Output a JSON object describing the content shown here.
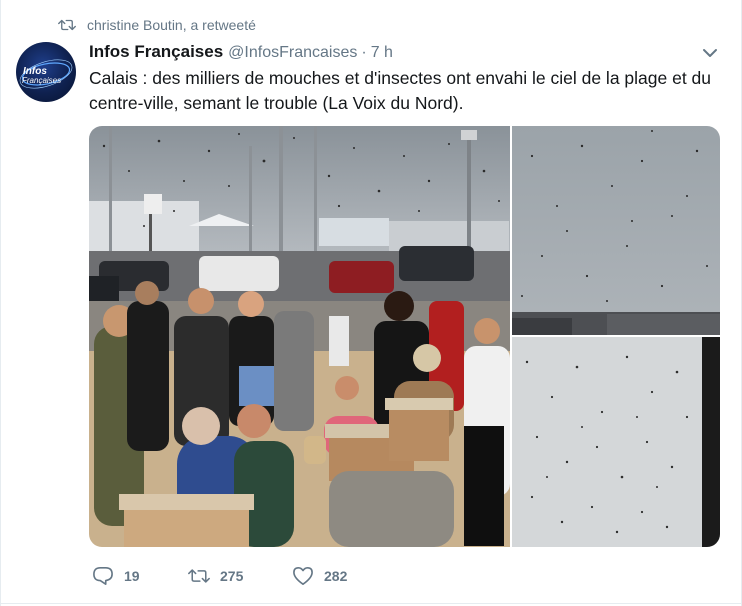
{
  "retweet": {
    "text": "christine Boutin, a retweeté",
    "icon": "retweet-icon"
  },
  "tweet": {
    "avatar_text": "Infos Françaises",
    "display_name": "Infos Françaises",
    "handle": "@InfosFrancaises",
    "separator": "·",
    "time": "7 h",
    "text_line1": "Calais : des milliers de mouches et d'insectes ont envahi le ciel de la plage et du",
    "text_line2": "centre-ville, semant le trouble (La Voix du Nord)."
  },
  "actions": {
    "reply_count": "19",
    "retweet_count": "275",
    "like_count": "282",
    "reply_icon": "reply-icon",
    "retweet_icon": "retweet-icon",
    "like_icon": "heart-icon"
  },
  "colors": {
    "text_primary": "#14171a",
    "text_secondary": "#657786",
    "border": "#e6ecf0"
  }
}
